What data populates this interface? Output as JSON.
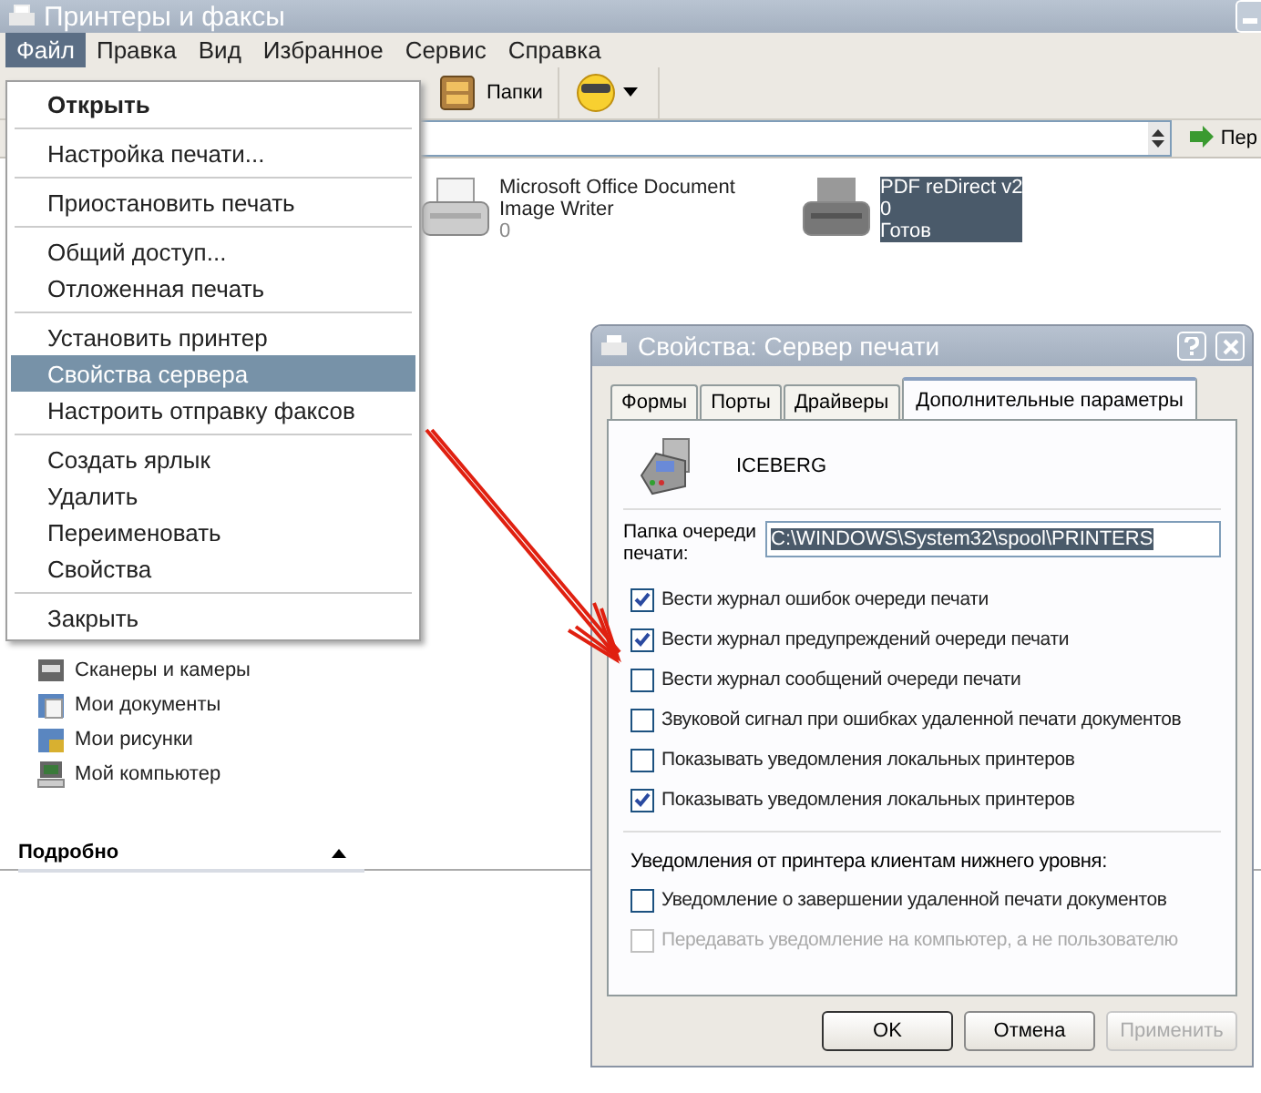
{
  "window": {
    "title": "Принтеры и факсы"
  },
  "menubar": [
    {
      "label": "Файл",
      "selected": true
    },
    {
      "label": "Правка",
      "selected": false
    },
    {
      "label": "Вид",
      "selected": false
    },
    {
      "label": "Избранное",
      "selected": false
    },
    {
      "label": "Сервис",
      "selected": false
    },
    {
      "label": "Справка",
      "selected": false
    }
  ],
  "toolbar": {
    "folders_label": "Папки"
  },
  "address_bar": {
    "go_label": "Пер"
  },
  "file_menu": [
    [
      {
        "label": "Открыть",
        "default": true,
        "selected": false
      }
    ],
    [
      {
        "label": "Настройка печати...",
        "default": false,
        "selected": false
      }
    ],
    [
      {
        "label": "Приостановить печать",
        "default": false,
        "selected": false
      }
    ],
    [
      {
        "label": "Общий доступ...",
        "default": false,
        "selected": false
      },
      {
        "label": "Отложенная печать",
        "default": false,
        "selected": false
      }
    ],
    [
      {
        "label": "Установить принтер",
        "default": false,
        "selected": false
      },
      {
        "label": "Свойства сервера",
        "default": false,
        "selected": true
      },
      {
        "label": "Настроить отправку факсов",
        "default": false,
        "selected": false
      }
    ],
    [
      {
        "label": "Создать ярлык",
        "default": false,
        "selected": false
      },
      {
        "label": "Удалить",
        "default": false,
        "selected": false
      },
      {
        "label": "Переименовать",
        "default": false,
        "selected": false
      },
      {
        "label": "Свойства",
        "default": false,
        "selected": false
      }
    ],
    [
      {
        "label": "Закрыть",
        "default": false,
        "selected": false
      }
    ]
  ],
  "sidebar": {
    "items": [
      {
        "label": "Сканеры и камеры",
        "kind": "scanner"
      },
      {
        "label": "Мои документы",
        "kind": "documents"
      },
      {
        "label": "Мои рисунки",
        "kind": "pictures"
      },
      {
        "label": "Мой компьютер",
        "kind": "computer"
      }
    ],
    "details_header": "Подробно"
  },
  "printers": [
    {
      "name": "Microsoft Office Document Image Writer",
      "jobs": "0",
      "selected": false
    },
    {
      "name": "PDF reDirect v2",
      "jobs": "0",
      "status": "Готов",
      "selected": true
    }
  ],
  "dialog": {
    "title": "Свойства: Сервер печати",
    "tabs": [
      {
        "label": "Формы",
        "selected": false
      },
      {
        "label": "Порты",
        "selected": false
      },
      {
        "label": "Драйверы",
        "selected": false
      },
      {
        "label": "Дополнительные параметры",
        "selected": true
      }
    ],
    "server_name": "ICEBERG",
    "spool_label": "Папка очереди печати:",
    "spool_path": "C:\\WINDOWS\\System32\\spool\\PRINTERS",
    "options": [
      {
        "label": "Вести журнал ошибок очереди печати",
        "checked": true,
        "disabled": false
      },
      {
        "label": "Вести журнал предупреждений очереди печати",
        "checked": true,
        "disabled": false
      },
      {
        "label": "Вести журнал сообщений очереди печати",
        "checked": false,
        "disabled": false
      },
      {
        "label": "Звуковой сигнал при ошибках удаленной печати документов",
        "checked": false,
        "disabled": false
      },
      {
        "label": "Показывать уведомления локальных принтеров",
        "checked": false,
        "disabled": false
      },
      {
        "label": "Показывать уведомления локальных принтеров",
        "checked": true,
        "disabled": false
      }
    ],
    "downlevel_label": "Уведомления от принтера клиентам нижнего уровня:",
    "downlevel_options": [
      {
        "label": "Уведомление о завершении удаленной печати документов",
        "checked": false,
        "disabled": false
      },
      {
        "label": "Передавать уведомление на компьютер, а не пользователю",
        "checked": false,
        "disabled": true
      }
    ],
    "buttons": [
      {
        "label": "OK",
        "disabled": false,
        "default": true
      },
      {
        "label": "Отмена",
        "disabled": false,
        "default": false
      },
      {
        "label": "Применить",
        "disabled": true,
        "default": false
      }
    ]
  }
}
